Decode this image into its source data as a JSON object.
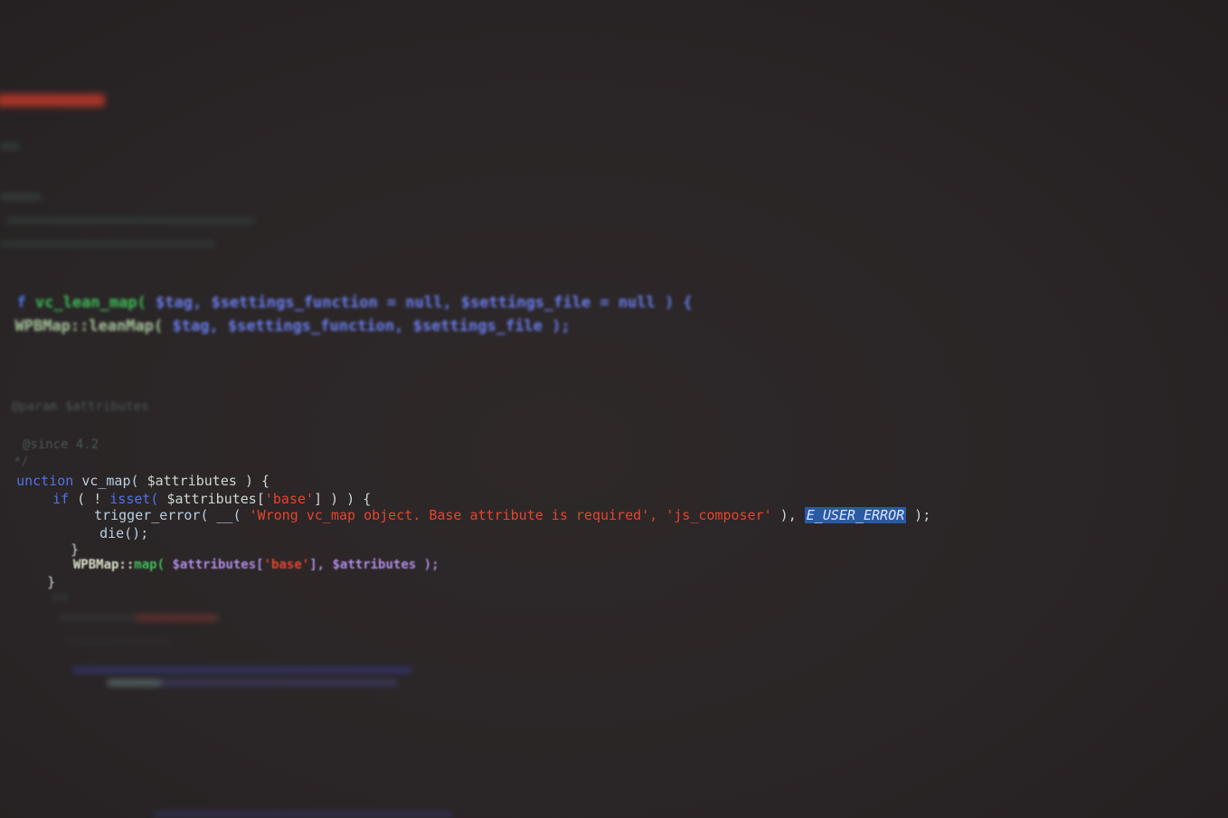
{
  "code": {
    "top_blurred": {
      "since_comment": "@since 4.2",
      "param_comment": "@param $attributes",
      "line_vc_lean_map_sig_1": "vc_lean_map(",
      "line_vc_lean_map_sig_2": "$tag, $settings_function = null, $settings_file = null ) {",
      "line_lean_map_call_1": "WPBMap::leanMap(",
      "line_lean_map_call_2": "$tag, $settings_function, $settings_file );"
    },
    "main": {
      "line1_kw": "unction",
      "line1_fn": "vc_map(",
      "line1_var": "$attributes",
      "line1_end": ") {",
      "line2_if": "if",
      "line2_open": "( !",
      "line2_isset": "isset(",
      "line2_var": "$attributes[",
      "line2_str": "'base'",
      "line2_end": "] ) ) {",
      "line3_fn": "trigger_error(",
      "line3_dunder": "__(",
      "line3_str1": "'Wrong vc_map object. Base attribute is required',",
      "line3_str2": "'js_composer'",
      "line3_close": "),",
      "line3_const": "E_USER_ERROR",
      "line3_end": ");",
      "line4": "die();",
      "line5": "}",
      "line6_class": "WPBMap::",
      "line6_map": "map(",
      "line6_var1": "$attributes[",
      "line6_str": "'base'",
      "line6_var2": "], $attributes",
      "line6_end": ");",
      "line7": "}"
    }
  },
  "colors": {
    "background": "#2a2526",
    "keyword": "#4f74e8",
    "variable": "#b08be6",
    "string": "#e5452f",
    "constant_highlight": "#2b5aa5",
    "green": "#3fbf5a"
  }
}
